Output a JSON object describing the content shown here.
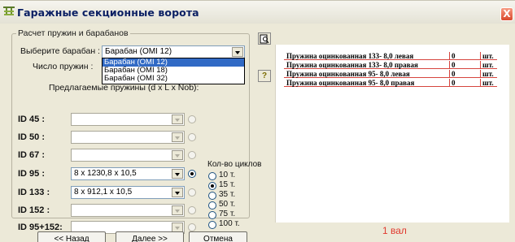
{
  "window": {
    "title": "Гаражные секционные ворота",
    "close_label": "X"
  },
  "group": {
    "title": "Расчет пружин и барабанов",
    "drum_label": "Выберите барабан :",
    "drum_value": "Барабан (OMI 12)",
    "drum_options": [
      "Барабан (OMI 12)",
      "Барабан (OMI 18)",
      "Барабан (OMI 32)"
    ],
    "spring_count_label": "Число пружин :",
    "proposed_label": "Предлагаемые пружины (d x L x Nob):"
  },
  "id_rows": [
    {
      "label": "ID 45 :",
      "value": "",
      "enabled": false
    },
    {
      "label": "ID 50 :",
      "value": "",
      "enabled": false
    },
    {
      "label": "ID 67 :",
      "value": "",
      "enabled": false
    },
    {
      "label": "ID 95 :",
      "value": "8 x 1230,8 x 10,5",
      "enabled": true
    },
    {
      "label": "ID 133 :",
      "value": "8 x 912,1 x 10,5",
      "enabled": true
    },
    {
      "label": "ID 152 :",
      "value": "",
      "enabled": false
    },
    {
      "label": "ID 95+152:",
      "value": "",
      "enabled": false
    }
  ],
  "cycles": {
    "title": "Кол-во циклов",
    "options": [
      "10 т.",
      "15 т.",
      "35 т.",
      "50 т.",
      "75 т.",
      "100 т."
    ],
    "selected": "15 т."
  },
  "spring_list": [
    {
      "name": "Пружина оцинкованная 133- 8,0 левая",
      "qty": "0",
      "unit": "шт."
    },
    {
      "name": "Пружина оцинкованная 133- 8,0 правая",
      "qty": "0",
      "unit": "шт."
    },
    {
      "name": "Пружина оцинкованная  95- 8,0 левая",
      "qty": "0",
      "unit": "шт."
    },
    {
      "name": "Пружина оцинкованная  95- 8,0 правая",
      "qty": "0",
      "unit": "шт."
    }
  ],
  "shaft_text": "1 вал",
  "buttons": {
    "back": "<< Назад",
    "next": "Далее >>",
    "cancel": "Отмена"
  },
  "side_buttons": {
    "preview_glyph": "Q",
    "help_glyph": "?"
  },
  "colors": {
    "title": "#0a1f63",
    "accent_red": "#e0392e",
    "window_bg": "#ece9d8",
    "selection": "#316ac5"
  }
}
